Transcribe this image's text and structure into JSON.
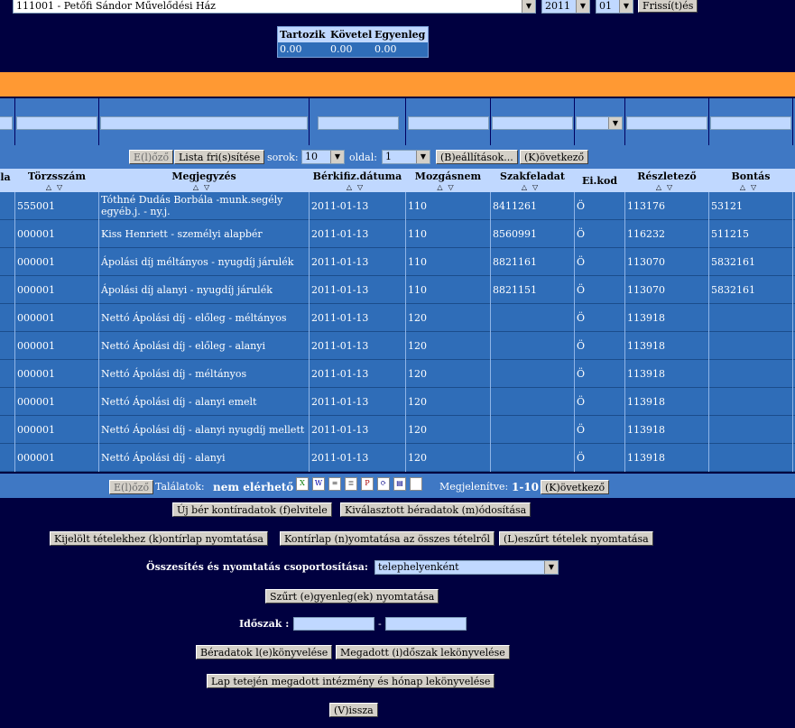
{
  "top": {
    "institution": "111001 - Petőfi Sándor Művelődési Ház",
    "year": "2011",
    "month": "01",
    "refresh_label": "Frissí(t)és"
  },
  "balance": {
    "headers": [
      "Tartozik",
      "Követel",
      "Egyenleg"
    ],
    "values": [
      "0.00",
      "0.00",
      "0.00"
    ]
  },
  "pager": {
    "prev_label": "E(l)őző",
    "refresh_list_label": "Lista fri(s)sítése",
    "rows_label": "sorok:",
    "rows_value": "10",
    "page_label": "oldal:",
    "page_value": "1",
    "settings_label": "(B)eállítások...",
    "next_label": "(K)övetkező"
  },
  "columns": {
    "c0": "la",
    "c1": "Törzsszám",
    "c2": "Megjegyzés",
    "c3": "Bérkifiz.dátuma",
    "c4": "Mozgásnem",
    "c5": "Szakfeladat",
    "c6": "Ei.kod",
    "c7": "Részletező",
    "c8": "Bontás"
  },
  "rows": [
    {
      "torzsszam": "555001",
      "megjegyzes": "Tóthné Dudás Borbála -munk.segély egyéb.j. - ny.j.",
      "datum": "2011-01-13",
      "mozgasnem": "110",
      "szakfeladat": "8411261",
      "eikod": "Ö",
      "reszletezo": "113176",
      "bontas": "53121"
    },
    {
      "torzsszam": "000001",
      "megjegyzes": "Kiss Henriett - személyi alapbér",
      "datum": "2011-01-13",
      "mozgasnem": "110",
      "szakfeladat": "8560991",
      "eikod": "Ö",
      "reszletezo": "116232",
      "bontas": "511215"
    },
    {
      "torzsszam": "000001",
      "megjegyzes": "Ápolási díj méltányos - nyugdíj járulék",
      "datum": "2011-01-13",
      "mozgasnem": "110",
      "szakfeladat": "8821161",
      "eikod": "Ö",
      "reszletezo": "113070",
      "bontas": "5832161"
    },
    {
      "torzsszam": "000001",
      "megjegyzes": "Ápolási díj alanyi - nyugdíj járulék",
      "datum": "2011-01-13",
      "mozgasnem": "110",
      "szakfeladat": "8821151",
      "eikod": "Ö",
      "reszletezo": "113070",
      "bontas": "5832161"
    },
    {
      "torzsszam": "000001",
      "megjegyzes": "Nettó Ápolási díj - előleg - méltányos",
      "datum": "2011-01-13",
      "mozgasnem": "120",
      "szakfeladat": "",
      "eikod": "Ö",
      "reszletezo": "113918",
      "bontas": ""
    },
    {
      "torzsszam": "000001",
      "megjegyzes": "Nettó Ápolási díj - előleg - alanyi",
      "datum": "2011-01-13",
      "mozgasnem": "120",
      "szakfeladat": "",
      "eikod": "Ö",
      "reszletezo": "113918",
      "bontas": ""
    },
    {
      "torzsszam": "000001",
      "megjegyzes": "Nettó Ápolási díj - méltányos",
      "datum": "2011-01-13",
      "mozgasnem": "120",
      "szakfeladat": "",
      "eikod": "Ö",
      "reszletezo": "113918",
      "bontas": ""
    },
    {
      "torzsszam": "000001",
      "megjegyzes": "Nettó Ápolási díj - alanyi emelt",
      "datum": "2011-01-13",
      "mozgasnem": "120",
      "szakfeladat": "",
      "eikod": "Ö",
      "reszletezo": "113918",
      "bontas": ""
    },
    {
      "torzsszam": "000001",
      "megjegyzes": "Nettó Ápolási díj - alanyi nyugdíj mellett",
      "datum": "2011-01-13",
      "mozgasnem": "120",
      "szakfeladat": "",
      "eikod": "Ö",
      "reszletezo": "113918",
      "bontas": ""
    },
    {
      "torzsszam": "000001",
      "megjegyzes": "Nettó Ápolási díj - alanyi",
      "datum": "2011-01-13",
      "mozgasnem": "120",
      "szakfeladat": "",
      "eikod": "Ö",
      "reszletezo": "113918",
      "bontas": ""
    }
  ],
  "footer": {
    "prev_label": "E(l)őző",
    "results_label": "Találatok:",
    "results_value": "nem elérhető",
    "shown_label": "Megjelenítve:",
    "shown_value": "1-10",
    "next_label": "(K)övetkező",
    "export_icons": [
      "excel-icon",
      "word-icon",
      "text-icon",
      "document-icon",
      "pdf-icon",
      "chart-icon",
      "html-icon",
      "blank-page-icon"
    ]
  },
  "actions": {
    "new_label": "Új bér kontíradatok (f)elvitele",
    "modify_label": "Kiválasztott béradatok (m)ódosítása",
    "print_selected_label": "Kijelölt tételekhez (k)ontírlap nyomtatása",
    "print_all_label": "Kontírlap (n)yomtatása az összes tételről",
    "print_filtered_label": "(L)eszűrt tételek nyomtatása",
    "grouping_label": "Összesítés és nyomtatás csoportosítása:",
    "grouping_value": "telephelyenként",
    "print_balance_label": "Szűrt (e)gyenleg(ek) nyomtatása",
    "period_label": "Időszak :",
    "period_dash": "-",
    "book_label": "Béradatok l(e)könyvelése",
    "book_period_label": "Megadott (i)dőszak lekönyvelése",
    "book_page_label": "Lap tetején megadott intézmény és hónap lekönyvelése",
    "back_label": "(V)issza"
  }
}
